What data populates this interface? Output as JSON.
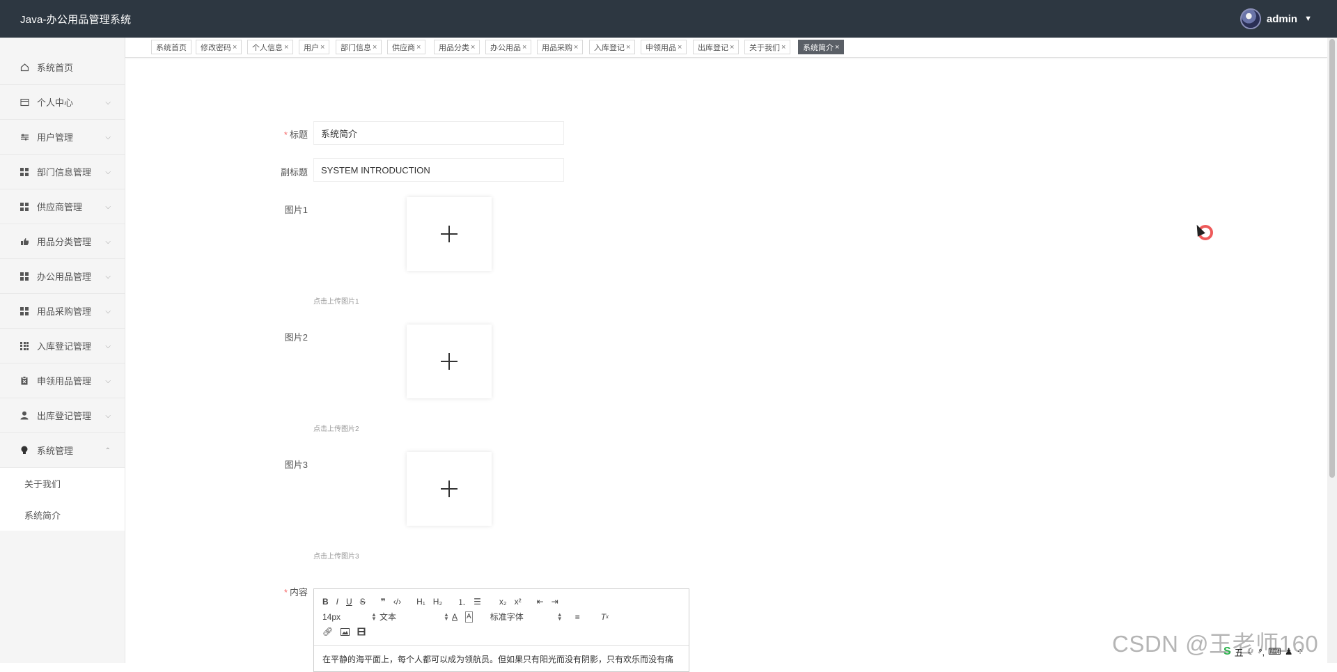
{
  "header": {
    "app_title": "Java-办公用品管理系统",
    "username": "admin"
  },
  "sidebar": {
    "items": [
      {
        "label": "系统首页",
        "icon": "home-icon"
      },
      {
        "label": "个人中心",
        "icon": "id-card-icon"
      },
      {
        "label": "用户管理",
        "icon": "sliders-icon"
      },
      {
        "label": "部门信息管理",
        "icon": "grid-icon"
      },
      {
        "label": "供应商管理",
        "icon": "grid-icon"
      },
      {
        "label": "用品分类管理",
        "icon": "thumbs-up-icon"
      },
      {
        "label": "办公用品管理",
        "icon": "grid-icon"
      },
      {
        "label": "用品采购管理",
        "icon": "grid-icon"
      },
      {
        "label": "入库登记管理",
        "icon": "grid9-icon"
      },
      {
        "label": "申领用品管理",
        "icon": "clipboard-icon"
      },
      {
        "label": "出库登记管理",
        "icon": "user-icon"
      },
      {
        "label": "系统管理",
        "icon": "bulb-icon"
      }
    ],
    "sub_items": [
      {
        "label": "关于我们"
      },
      {
        "label": "系统简介"
      }
    ]
  },
  "tabs": [
    {
      "label": "系统首页",
      "closable": false
    },
    {
      "label": "修改密码",
      "closable": true
    },
    {
      "label": "个人信息",
      "closable": true
    },
    {
      "label": "用户",
      "closable": true
    },
    {
      "label": "部门信息",
      "closable": true
    },
    {
      "label": "供应商",
      "closable": true
    },
    {
      "label": "用品分类",
      "closable": true
    },
    {
      "label": "办公用品",
      "closable": true
    },
    {
      "label": "用品采购",
      "closable": true
    },
    {
      "label": "入库登记",
      "closable": true
    },
    {
      "label": "申领用品",
      "closable": true
    },
    {
      "label": "出库登记",
      "closable": true
    },
    {
      "label": "关于我们",
      "closable": true
    },
    {
      "label": "系统简介",
      "closable": true,
      "active": true
    }
  ],
  "form": {
    "title_label": "标题",
    "title_value": "系统简介",
    "subtitle_label": "副标题",
    "subtitle_value": "SYSTEM INTRODUCTION",
    "pic1_label": "图片1",
    "pic1_hint": "点击上传图片1",
    "pic2_label": "图片2",
    "pic2_hint": "点击上传图片2",
    "pic3_label": "图片3",
    "pic3_hint": "点击上传图片3",
    "content_label": "内容"
  },
  "editor": {
    "font_size": "14px",
    "block_format": "文本",
    "font_family": "标准字体",
    "content_text": "在平静的海平面上，每个人都可以成为领航员。但如果只有阳光而没有阴影，只有欢乐而没有痛"
  },
  "overlay": {
    "watermark": "CSDN @王老师160",
    "tray_text": "五"
  },
  "colors": {
    "header_bg": "#2d3741",
    "active_tab_bg": "#5a5f66",
    "required_star": "#f56c6c"
  }
}
